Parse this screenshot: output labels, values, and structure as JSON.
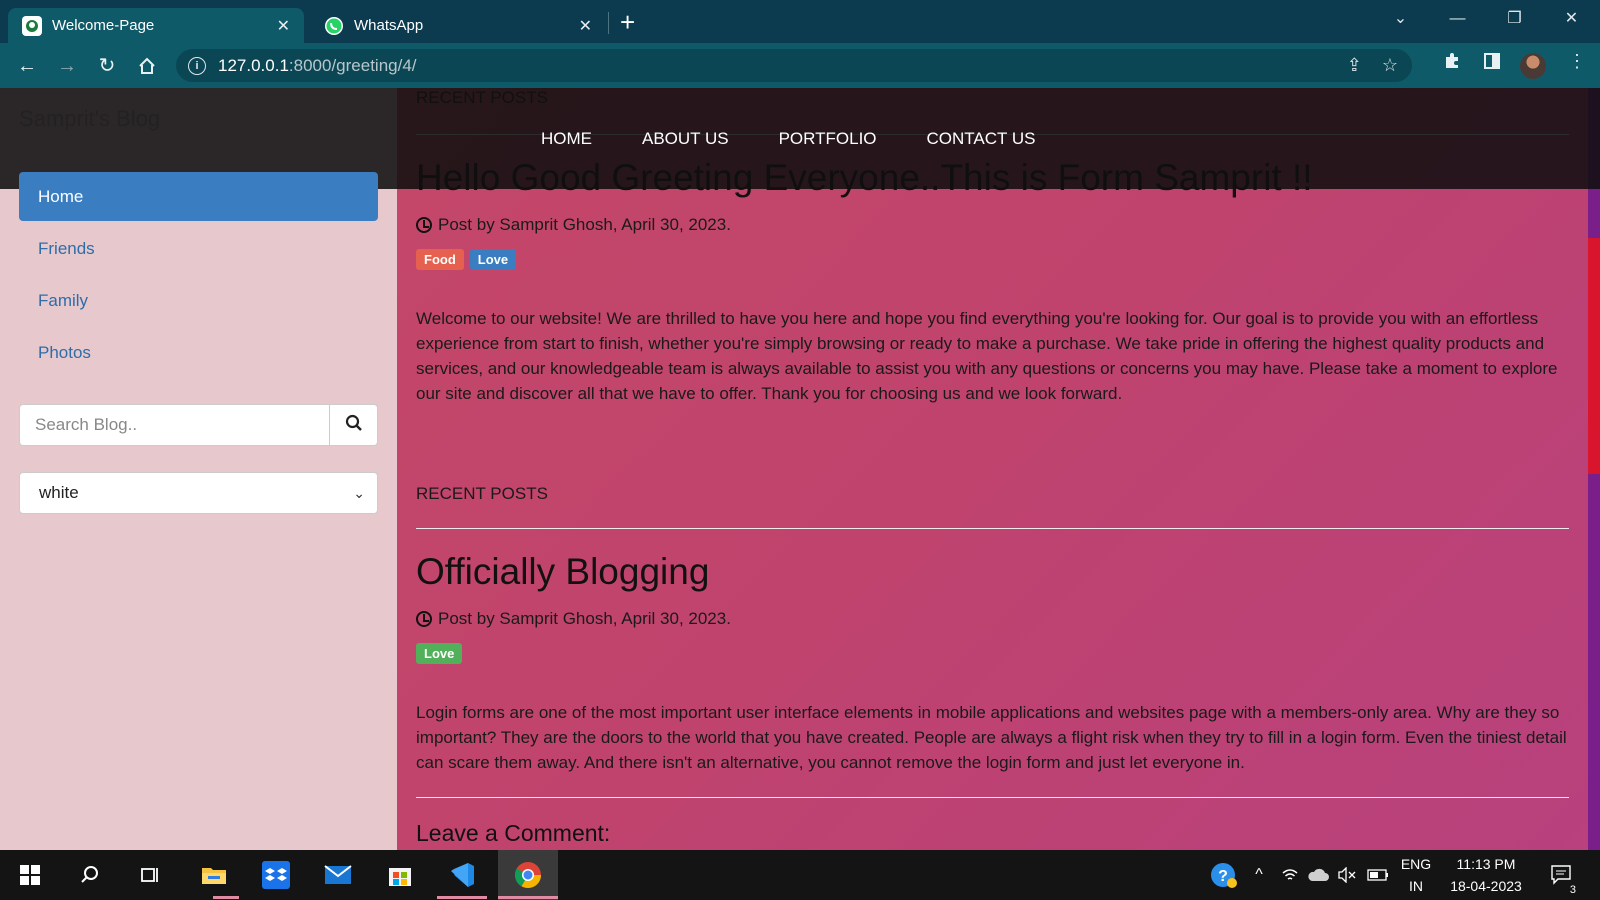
{
  "browser": {
    "tabs": [
      {
        "title": "Welcome-Page",
        "active": true,
        "icon": "site-favicon"
      },
      {
        "title": "WhatsApp",
        "active": false,
        "icon": "whatsapp-icon"
      }
    ],
    "url_host": "127.0.0.1",
    "url_rest": ":8000/greeting/4/"
  },
  "site": {
    "brand": "Samprit's Blog",
    "menu": [
      "HOME",
      "ABOUT US",
      "PORTFOLIO",
      "CONTACT US"
    ],
    "sidebar": {
      "items": [
        {
          "label": "Home",
          "active": true
        },
        {
          "label": "Friends",
          "active": false
        },
        {
          "label": "Family",
          "active": false
        },
        {
          "label": "Photos",
          "active": false
        }
      ],
      "search_placeholder": "Search Blog..",
      "theme_value": "white"
    },
    "recent_label": "RECENT POSTS",
    "posts": [
      {
        "title": "Hello Good Greeting Everyone..This is Form Samprit !!",
        "meta": "Post by Samprit Ghosh, April 30, 2023.",
        "tags": [
          {
            "label": "Food",
            "color": "#e5604f"
          },
          {
            "label": "Love",
            "color": "#3a7ec1"
          }
        ],
        "body": "Welcome to our website! We are thrilled to have you here and hope you find everything you're looking for. Our goal is to provide you with an effortless experience from start to finish, whether you're simply browsing or ready to make a purchase. We take pride in offering the highest quality products and services, and our knowledgeable team is always available to assist you with any questions or concerns you may have. Please take a moment to explore our site and discover all that we have to offer. Thank you for choosing us and we look forward."
      },
      {
        "title": "Officially Blogging",
        "meta": "Post by Samprit Ghosh, April 30, 2023.",
        "tags": [
          {
            "label": "Love",
            "color": "#52b05a"
          }
        ],
        "body": "Login forms are one of the most important user interface elements in mobile applications and websites page with a members-only area. Why are they so important? They are the doors to the world that you have created. People are always a flight risk when they try to fill in a login form. Even the tiniest detail can scare them away. And there isn't an alternative, you cannot remove the login form and just let everyone in."
      }
    ],
    "comment_heading": "Leave a Comment:"
  },
  "taskbar": {
    "lang_top": "ENG",
    "lang_bottom": "IN",
    "time": "11:13 PM",
    "date": "18-04-2023",
    "notif_count": "3"
  },
  "colors": {
    "accent": "#3a7ec1",
    "page_bg": "#c0436d",
    "sidebar_bg": "#e6c8cd"
  }
}
